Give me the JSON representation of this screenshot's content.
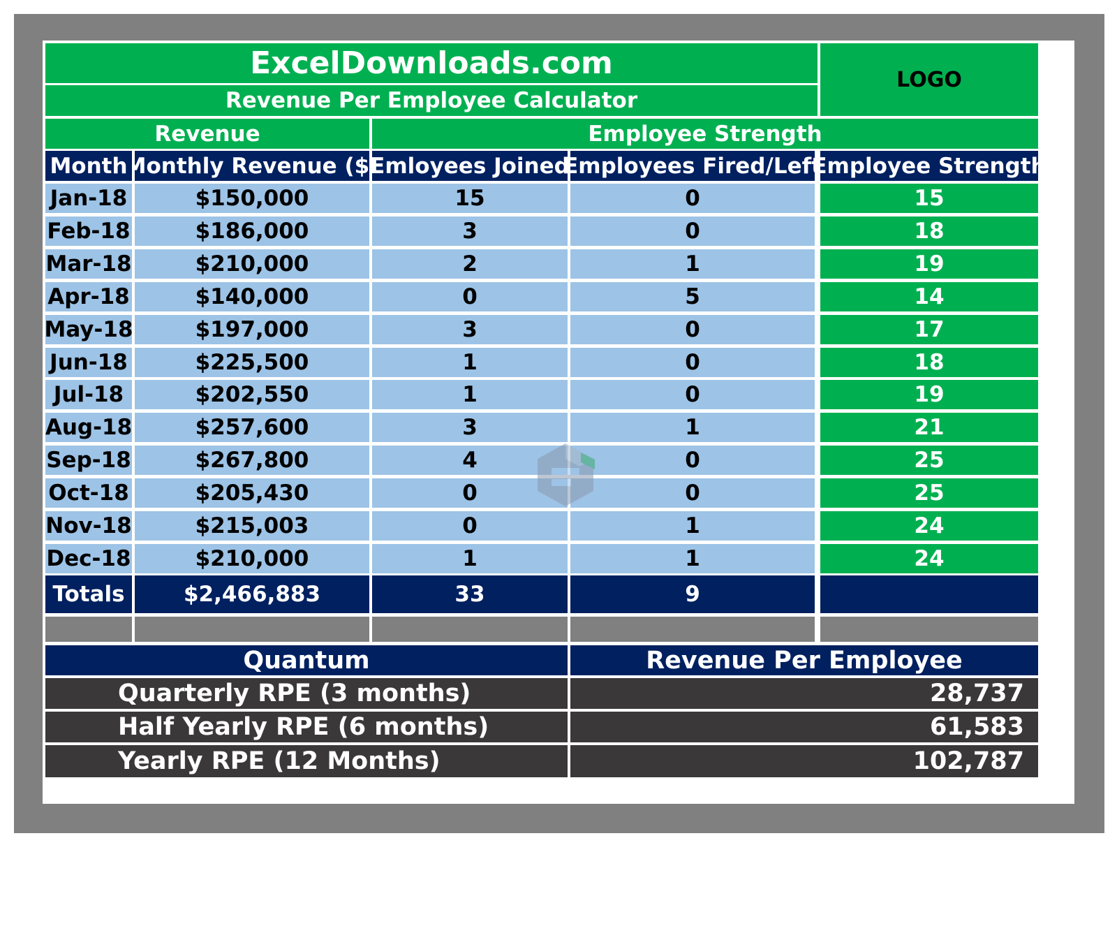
{
  "header": {
    "site": "ExcelDownloads.com",
    "subtitle": "Revenue Per Employee Calculator",
    "logo": "LOGO"
  },
  "sections": {
    "revenue": "Revenue",
    "employee_strength": "Employee Strength"
  },
  "columns": [
    "Month",
    "Monthly Revenue ($)",
    "Emloyees Joined",
    "Employees Fired/Left",
    "Employee Strength"
  ],
  "rows": [
    {
      "month": "Jan-18",
      "revenue": "$150,000",
      "joined": "15",
      "left": "0",
      "strength": "15"
    },
    {
      "month": "Feb-18",
      "revenue": "$186,000",
      "joined": "3",
      "left": "0",
      "strength": "18"
    },
    {
      "month": "Mar-18",
      "revenue": "$210,000",
      "joined": "2",
      "left": "1",
      "strength": "19"
    },
    {
      "month": "Apr-18",
      "revenue": "$140,000",
      "joined": "0",
      "left": "5",
      "strength": "14"
    },
    {
      "month": "May-18",
      "revenue": "$197,000",
      "joined": "3",
      "left": "0",
      "strength": "17"
    },
    {
      "month": "Jun-18",
      "revenue": "$225,500",
      "joined": "1",
      "left": "0",
      "strength": "18"
    },
    {
      "month": "Jul-18",
      "revenue": "$202,550",
      "joined": "1",
      "left": "0",
      "strength": "19"
    },
    {
      "month": "Aug-18",
      "revenue": "$257,600",
      "joined": "3",
      "left": "1",
      "strength": "21"
    },
    {
      "month": "Sep-18",
      "revenue": "$267,800",
      "joined": "4",
      "left": "0",
      "strength": "25"
    },
    {
      "month": "Oct-18",
      "revenue": "$205,430",
      "joined": "0",
      "left": "0",
      "strength": "25"
    },
    {
      "month": "Nov-18",
      "revenue": "$215,003",
      "joined": "0",
      "left": "1",
      "strength": "24"
    },
    {
      "month": "Dec-18",
      "revenue": "$210,000",
      "joined": "1",
      "left": "1",
      "strength": "24"
    }
  ],
  "totals": {
    "label": "Totals",
    "revenue": "$2,466,883",
    "joined": "33",
    "left": "9",
    "strength": ""
  },
  "rpe": {
    "header_quantum": "Quantum",
    "header_value": "Revenue Per Employee",
    "rows": [
      {
        "label": "Quarterly RPE (3 months)",
        "value": "28,737"
      },
      {
        "label": "Half Yearly RPE (6 months)",
        "value": "61,583"
      },
      {
        "label": "Yearly RPE (12 Months)",
        "value": "102,787"
      }
    ]
  },
  "colors": {
    "green": "#00b050",
    "navy": "#002060",
    "light_blue": "#9dc3e6",
    "frame_grey": "#808080",
    "dark": "#3a3838"
  },
  "icons": {
    "watermark": "exceldownloads-logo-icon"
  }
}
